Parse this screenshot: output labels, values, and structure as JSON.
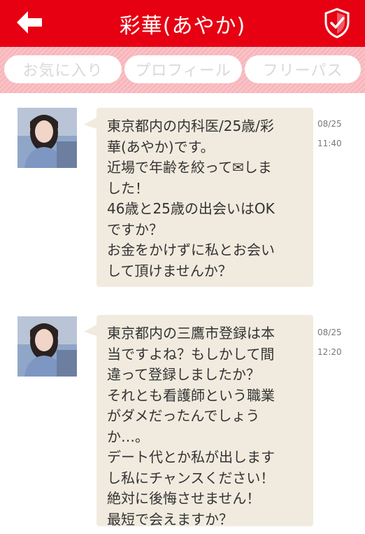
{
  "header": {
    "title": "彩華(あやか)",
    "back_icon": "arrow-left-icon",
    "shield_icon": "shield-check-icon",
    "color": "#e60012"
  },
  "tabs": [
    {
      "label": "お気に入り"
    },
    {
      "label": "プロフィール"
    },
    {
      "label": "フリーパス"
    }
  ],
  "messages": [
    {
      "text": "東京都内の内科医/25歳/彩\n華(あやか)です。\n近場で年齢を絞って✉しま\nした！\n46歳と25歳の出会いはOK\nですか？\nお金をかけずに私とお会い\nして頂けませんか？",
      "date": "08/25",
      "time": "11:40"
    },
    {
      "text": "東京都内の三鷹市登録は本\n当ですよね？もしかして間\n違って登録しましたか？\nそれとも看護師という職業\nがダメだったんでしょう\nか…。\nデート代とか私が出します\nし私にチャンスください！\n絶対に後悔させません！\n最短で会えますか？",
      "date": "08/25",
      "time": "12:20"
    }
  ]
}
